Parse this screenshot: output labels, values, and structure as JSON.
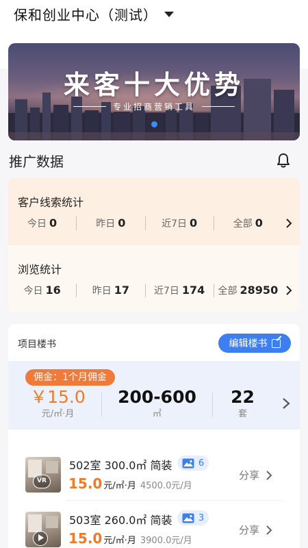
{
  "header": {
    "title": "保和创业中心（测试）"
  },
  "banner": {
    "title": "来客十大优势",
    "subtitle": "专业招商营销工具"
  },
  "promo": {
    "title": "推广数据",
    "leads": {
      "label": "客户线索统计",
      "items": [
        {
          "name": "今日",
          "value": "0"
        },
        {
          "name": "昨日",
          "value": "0"
        },
        {
          "name": "近7日",
          "value": "0"
        },
        {
          "name": "全部",
          "value": "0"
        }
      ]
    },
    "views": {
      "label": "浏览统计",
      "items": [
        {
          "name": "今日",
          "value": "16"
        },
        {
          "name": "昨日",
          "value": "17"
        },
        {
          "name": "近7日",
          "value": "174"
        },
        {
          "name": "全部",
          "value": "28950"
        }
      ]
    }
  },
  "project": {
    "title": "项目楼书",
    "edit_label": "编辑楼书",
    "commission": {
      "badge": "佣金：1个月佣金",
      "price": "￥15.0",
      "price_unit": "元/㎡·月",
      "area": "200-600",
      "area_unit": "㎡",
      "count": "22",
      "count_unit": "套"
    },
    "listings": [
      {
        "title": "502室 300.0㎡ 简装",
        "images": "6",
        "price": "15.0",
        "unit": "元/㎡·月",
        "total": "4500.0元/月",
        "share": "分享",
        "media": "VR"
      },
      {
        "title": "503室 260.0㎡ 简装",
        "images": "3",
        "price": "15.0",
        "unit": "元/㎡·月",
        "total": "3900.0元/月",
        "share": "分享",
        "media": "video"
      }
    ]
  },
  "colors": {
    "accent": "#3d7ff0",
    "price": "#f07a2a",
    "leads_bg": "#fdf0e2",
    "views_bg": "#fdf8f2",
    "commission_bg": "#ecf1fb"
  }
}
